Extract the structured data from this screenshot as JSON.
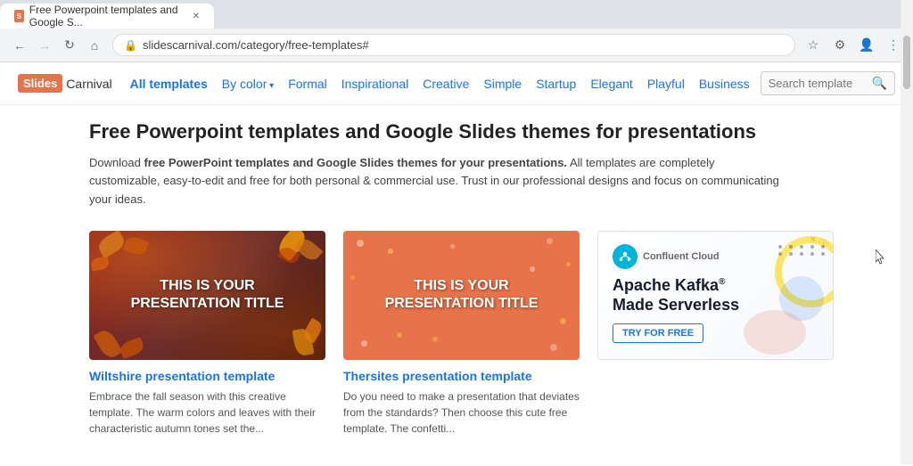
{
  "browser": {
    "address": "slidescarnival.com/category/free-templates#",
    "tab_title": "Free Powerpoint templates and Google S...",
    "back_disabled": false,
    "forward_disabled": false
  },
  "logo": {
    "slides": "Slides",
    "carnival": "Carnival"
  },
  "nav": {
    "links": [
      {
        "label": "All templates",
        "active": true,
        "dropdown": false
      },
      {
        "label": "By color",
        "active": false,
        "dropdown": true
      },
      {
        "label": "Formal",
        "active": false,
        "dropdown": false
      },
      {
        "label": "Inspirational",
        "active": false,
        "dropdown": false
      },
      {
        "label": "Creative",
        "active": false,
        "dropdown": false
      },
      {
        "label": "Simple",
        "active": false,
        "dropdown": false
      },
      {
        "label": "Startup",
        "active": false,
        "dropdown": false
      },
      {
        "label": "Elegant",
        "active": false,
        "dropdown": false
      },
      {
        "label": "Playful",
        "active": false,
        "dropdown": false
      },
      {
        "label": "Business",
        "active": false,
        "dropdown": false
      }
    ],
    "search_placeholder": "Search template"
  },
  "page": {
    "title": "Free Powerpoint templates and Google Slides themes for presentations",
    "desc_prefix": "Download ",
    "desc_bold": "free PowerPoint templates and Google Slides themes for your presentations.",
    "desc_suffix": " All templates are completely customizable, easy-to-edit and free for both personal & commercial use. Trust in our professional designs and focus on communicating your ideas."
  },
  "templates": [
    {
      "id": "wiltshire",
      "name": "Wiltshire presentation template",
      "desc": "Embrace the fall season with this creative template. The warm colors and leaves with their characteristic autumn tones set the...",
      "thumb_type": "autumn"
    },
    {
      "id": "thersites",
      "name": "Thersites presentation template",
      "desc": "Do you need to make a presentation that deviates from the standards? Then choose this cute free template. The confetti...",
      "thumb_type": "coral"
    }
  ],
  "ad": {
    "company": "Confluent Cloud",
    "headline": "Apache Kafka®\nMade Serverless",
    "cta": "TRY FOR FREE",
    "label": "ⓘ",
    "close": "✕"
  },
  "presentation_title": "THIS IS YOUR\nPRESENTATION TITLE"
}
